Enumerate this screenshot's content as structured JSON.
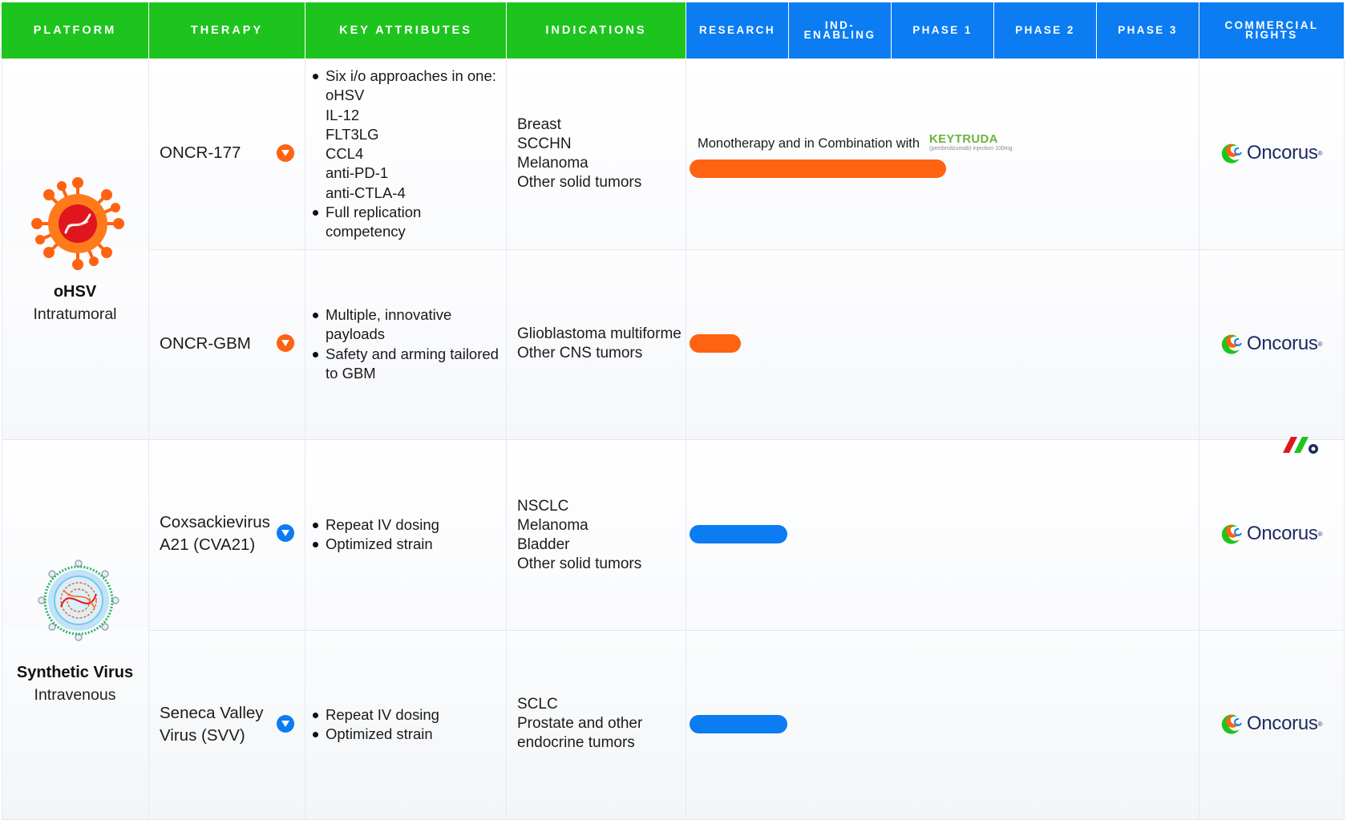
{
  "chart_data": {
    "type": "table",
    "headers": {
      "platform": "PLATFORM",
      "therapy": "THERAPY",
      "key_attributes": "KEY ATTRIBUTES",
      "indications": "INDICATIONS",
      "research": "RESEARCH",
      "ind_enabling_1": "IND-",
      "ind_enabling_2": "ENABLING",
      "phase1": "PHASE 1",
      "phase2": "PHASE 2",
      "phase3": "PHASE 3",
      "commercial_1": "COMMERCIAL",
      "commercial_2": "RIGHTS"
    },
    "stage_order": [
      "Research",
      "IND-Enabling",
      "Phase 1",
      "Phase 2",
      "Phase 3"
    ],
    "platforms": [
      {
        "name": "oHSV",
        "route": "Intratumoral",
        "icon": "ohsv-virus-icon"
      },
      {
        "name": "Synthetic Virus",
        "route": "Intravenous",
        "icon": "synthetic-virus-icon"
      }
    ],
    "rows": [
      {
        "therapy": "ONCR-177",
        "marker_color": "#ff6210",
        "attributes": [
          "Six i/o approaches in one:",
          "oHSV",
          "IL-12",
          "FLT3LG",
          "CCL4",
          "anti-PD-1",
          "anti-CTLA-4",
          "Full replication",
          "competency"
        ],
        "indications": [
          "Breast",
          "SCCHN",
          "Melanoma",
          "Other solid tumors"
        ],
        "progress_stages": 2.5,
        "note": "Monotherapy and in Combination with",
        "partner_name": "KEYTRUDA",
        "partner_sub": "(pembrolizumab) injection 100mg",
        "rights": "Oncorus"
      },
      {
        "therapy": "ONCR-GBM",
        "marker_color": "#ff6210",
        "attributes": [
          "Multiple, innovative",
          "payloads",
          "Safety and arming tailored",
          "to GBM"
        ],
        "indications": [
          "Glioblastoma multiforme",
          "Other CNS tumors"
        ],
        "progress_stages": 0.5,
        "rights": "Oncorus"
      },
      {
        "therapy_1": "Coxsackievirus",
        "therapy_2": "A21 (CVA21)",
        "marker_color": "#0b7cf2",
        "attributes": [
          "Repeat IV dosing",
          "Optimized strain"
        ],
        "indications": [
          "NSCLC",
          "Melanoma",
          "Bladder",
          "Other solid tumors"
        ],
        "progress_stages": 0.95,
        "rights": "Oncorus"
      },
      {
        "therapy_1": "Seneca Valley",
        "therapy_2": "Virus (SVV)",
        "marker_color": "#0b7cf2",
        "attributes": [
          "Repeat IV dosing",
          "Optimized strain"
        ],
        "indications": [
          "SCLC",
          "Prostate and other",
          "endocrine tumors"
        ],
        "progress_stages": 0.95,
        "rights": "Oncorus"
      }
    ]
  },
  "colors": {
    "green": "#1ec41e",
    "blue": "#0b7cf2",
    "orange": "#ff6210",
    "navy": "#1d2a5e"
  }
}
